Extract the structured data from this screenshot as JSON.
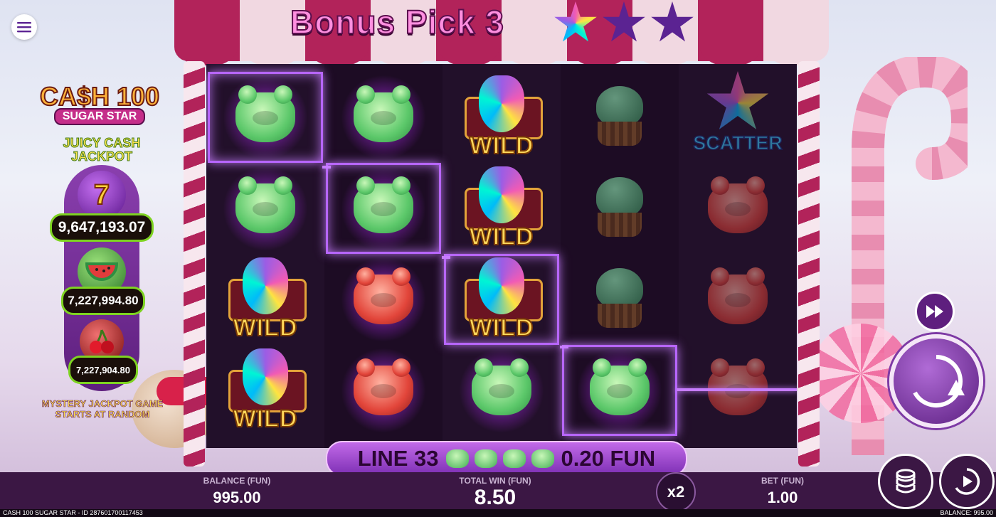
{
  "header": {
    "title": "Bonus Pick 3",
    "stars": [
      "filled",
      "empty",
      "empty"
    ]
  },
  "jackpot": {
    "logo_main": "CA$H 100",
    "logo_sub": "SUGAR STAR",
    "title": "JUICY CASH JACKPOT",
    "tiers": [
      {
        "icon": "seven-icon",
        "value": "9,647,193.07"
      },
      {
        "icon": "watermelon-icon",
        "value": "7,227,994.80"
      },
      {
        "icon": "cherry-icon",
        "value": "7,227,904.80"
      }
    ],
    "mystery": "MYSTERY JACKPOT GAME STARTS AT RANDOM"
  },
  "reels": {
    "wild_label": "WILD",
    "scatter_label": "SCATTER",
    "grid": [
      [
        "green-bear",
        "green-bear",
        "wild",
        "cupcake",
        "scatter"
      ],
      [
        "green-bear",
        "green-bear",
        "wild",
        "cupcake",
        "red-bear"
      ],
      [
        "wild",
        "red-bear",
        "wild",
        "cupcake",
        "red-bear"
      ],
      [
        "wild",
        "red-bear",
        "green-bear",
        "green-bear",
        "red-bear"
      ]
    ],
    "winning_cells": [
      [
        0,
        0
      ],
      [
        1,
        1
      ],
      [
        2,
        2
      ],
      [
        3,
        3
      ]
    ]
  },
  "win_line": {
    "line_label": "LINE 33",
    "amount": "0.20 FUN",
    "symbol_count": 4
  },
  "bottom_bar": {
    "balance_label": "BALANCE (FUN)",
    "balance_value": "995.00",
    "total_win_label": "TOTAL WIN (FUN)",
    "total_win_value": "8.50",
    "multiplier": "x2",
    "bet_label": "BET (FUN)",
    "bet_value": "1.00"
  },
  "status_bar": {
    "game_id": "CASH 100 SUGAR STAR - ID 287601700117453",
    "balance": "BALANCE: 995.00"
  },
  "colors": {
    "accent": "#c77dff",
    "bar": "#3b1744",
    "jackpot_border": "#7ed321"
  }
}
